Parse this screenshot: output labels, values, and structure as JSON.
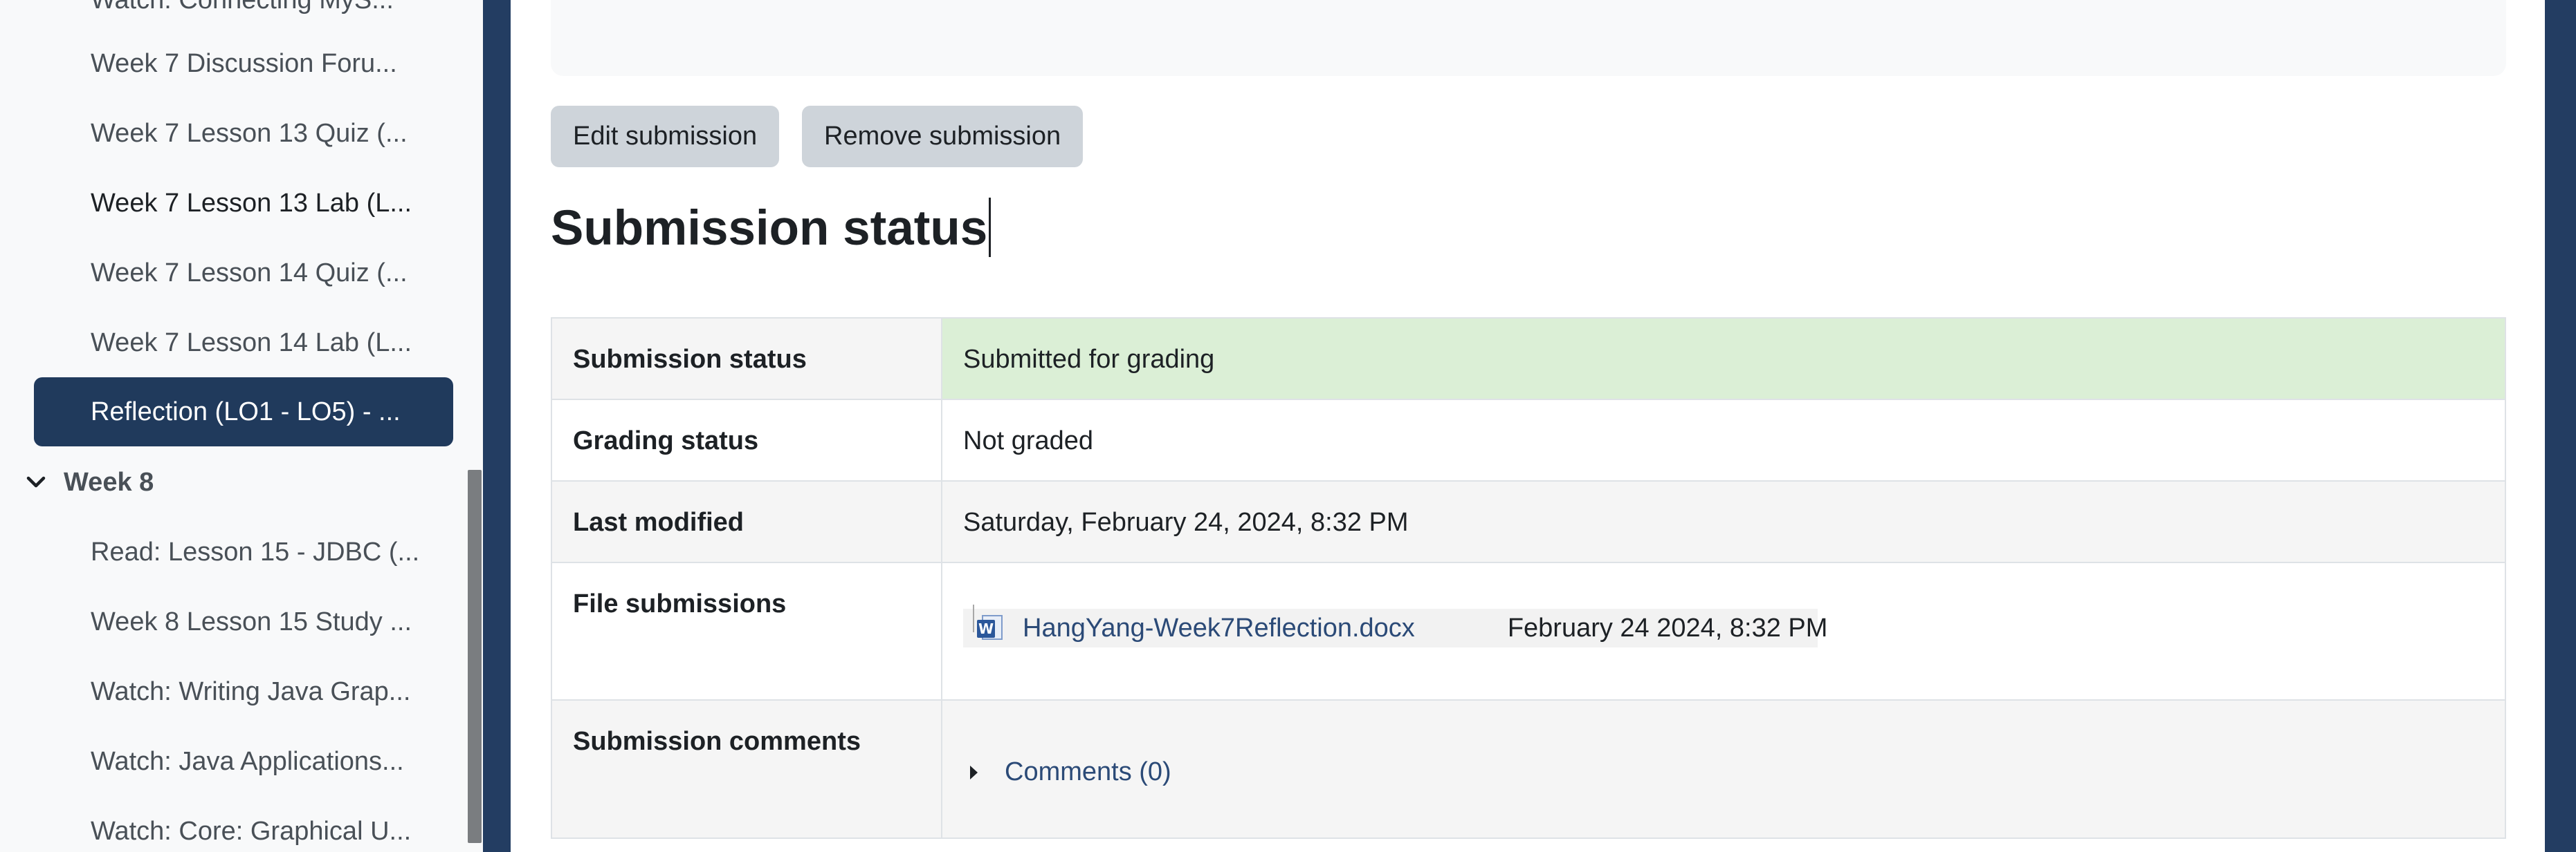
{
  "sidebar": {
    "items": [
      {
        "label": "Watch: Connecting MyS..."
      },
      {
        "label": "Week 7 Discussion Foru..."
      },
      {
        "label": "Week 7 Lesson 13 Quiz (..."
      },
      {
        "label": "Week 7 Lesson 13 Lab (L..."
      },
      {
        "label": "Week 7 Lesson 14 Quiz (..."
      },
      {
        "label": "Week 7 Lesson 14 Lab (L..."
      },
      {
        "label": "Reflection (LO1 - LO5) - ..."
      }
    ],
    "week8": {
      "header": "Week 8",
      "items": [
        {
          "label": "Read: Lesson 15 - JDBC (..."
        },
        {
          "label": "Week 8 Lesson 15 Study ..."
        },
        {
          "label": "Watch: Writing Java Grap..."
        },
        {
          "label": "Watch: Java Applications..."
        },
        {
          "label": "Watch: Core: Graphical U..."
        }
      ]
    }
  },
  "actions": {
    "edit_label": "Edit submission",
    "remove_label": "Remove submission"
  },
  "page_title": "Submission status",
  "status_table": {
    "submission_status_label": "Submission status",
    "submission_status_value": "Submitted for grading",
    "grading_status_label": "Grading status",
    "grading_status_value": "Not graded",
    "last_modified_label": "Last modified",
    "last_modified_value": "Saturday, February 24, 2024, 8:32 PM",
    "file_submissions_label": "File submissions",
    "file": {
      "name": "HangYang-Week7Reflection.docx",
      "date": "February 24 2024, 8:32 PM"
    },
    "comments_label": "Submission comments",
    "comments_link": "Comments (0)"
  },
  "colors": {
    "accent": "#203a5c",
    "success_bg": "#dbefd6",
    "link": "#2b4a77"
  }
}
